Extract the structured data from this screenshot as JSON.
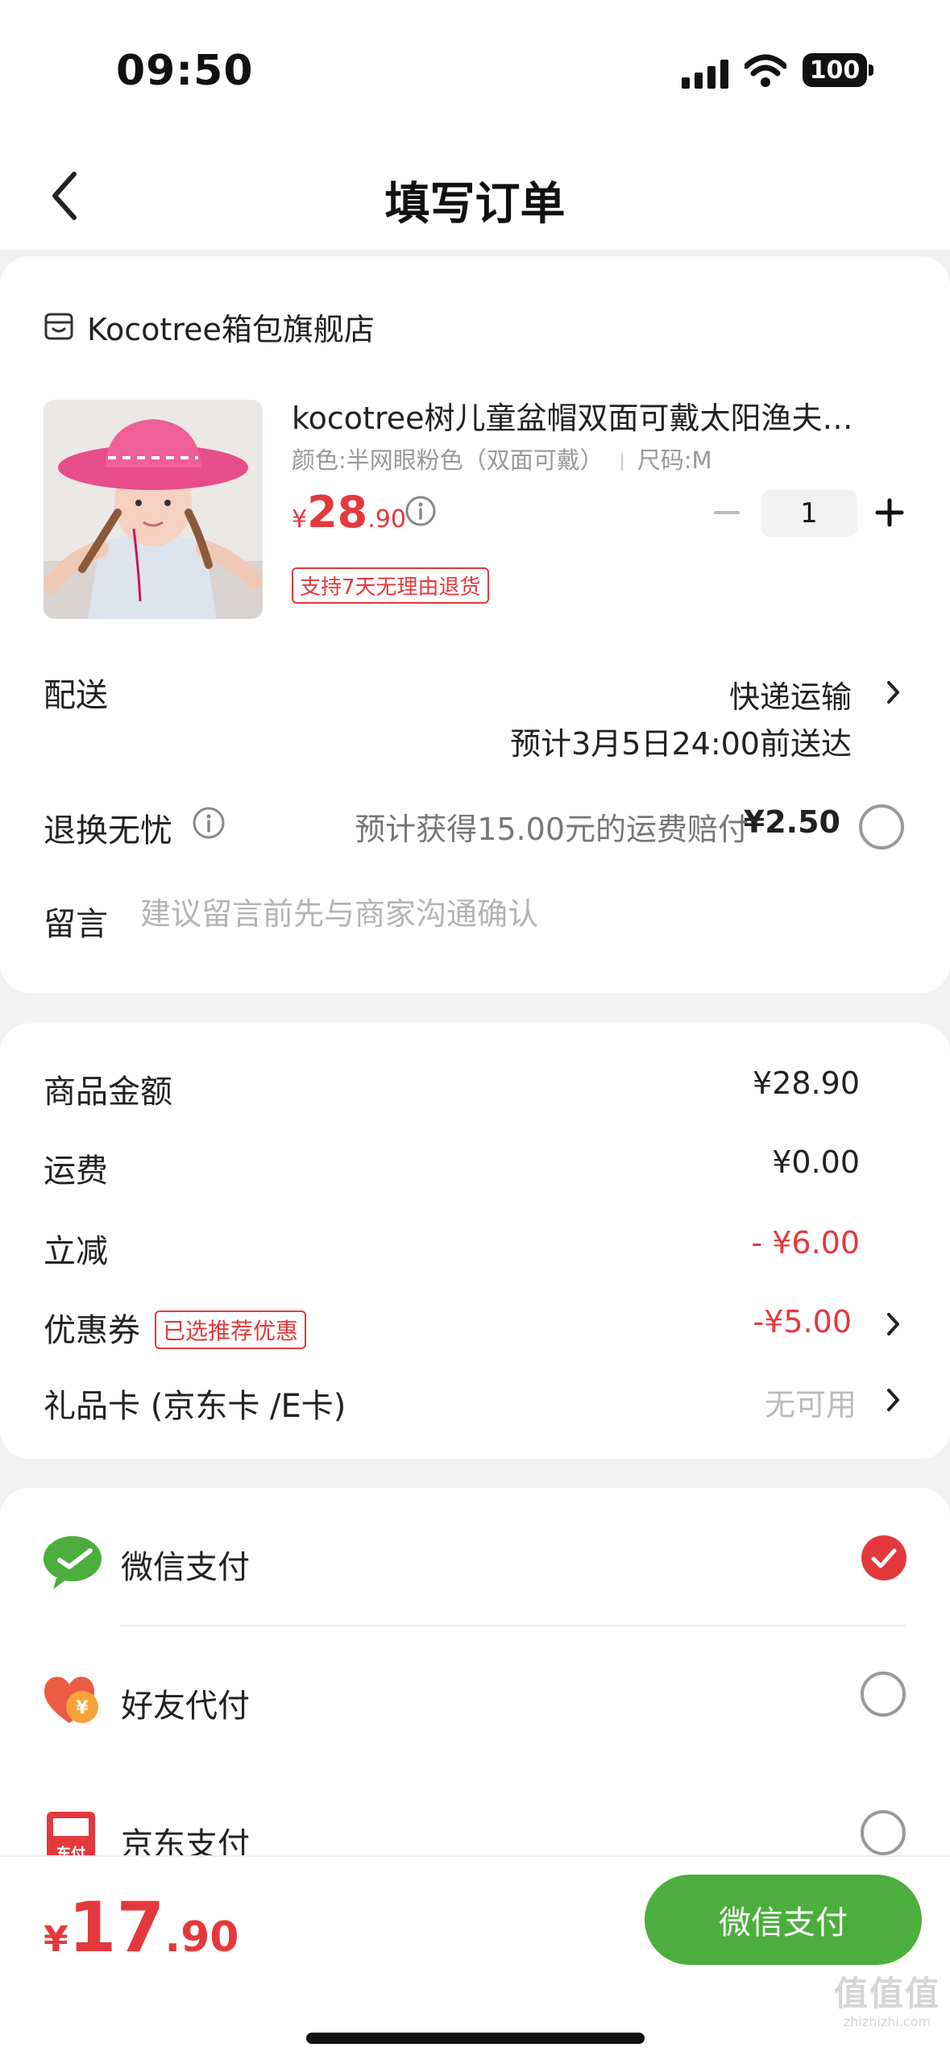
{
  "status_bar": {
    "time": "09:50",
    "battery": "100"
  },
  "nav": {
    "title": "填写订单"
  },
  "store": {
    "name": "Kocotree箱包旗舰店"
  },
  "product": {
    "title": "kocotree树儿童盆帽双面可戴太阳渔夫…",
    "color_spec": "颜色:半网眼粉色（双面可戴）",
    "size_spec": "尺码:M",
    "price_symbol": "¥",
    "price_int": "28",
    "price_dec": ".90",
    "quantity": "1",
    "return_badge": "支持7天无理由退货"
  },
  "delivery": {
    "label": "配送",
    "method": "快递运输",
    "eta": "预计3月5日24:00前送达"
  },
  "worry_free": {
    "label": "退换无忧",
    "desc": "预计获得15.00元的运费赔付",
    "price": "¥2.50"
  },
  "message": {
    "label": "留言",
    "placeholder": "建议留言前先与商家沟通确认"
  },
  "amounts": {
    "goods_label": "商品金额",
    "goods_value": "¥28.90",
    "shipping_label": "运费",
    "shipping_value": "¥0.00",
    "discount_label": "立减",
    "discount_value": "- ¥6.00",
    "coupon_label": "优惠券",
    "coupon_badge": "已选推荐优惠",
    "coupon_value": "-¥5.00",
    "giftcard_label": "礼品卡 (京东卡 /E卡)",
    "giftcard_value": "无可用"
  },
  "payment": {
    "methods": [
      {
        "label": "微信支付",
        "selected": true
      },
      {
        "label": "好友代付",
        "selected": false
      },
      {
        "label": "京东支付",
        "selected": false
      }
    ],
    "friend_icon_text": "¥",
    "jd_icon_text": "东付"
  },
  "bottom": {
    "total_symbol": "¥",
    "total_int": "17",
    "total_dec": ".90",
    "pay_button": "微信支付",
    "watermark_big": "值值值",
    "watermark_small": "zhizhizhi.com"
  },
  "colors": {
    "accent_red": "#e4393c",
    "wechat_green": "#4cae3d",
    "background": "#f2f2f2"
  }
}
